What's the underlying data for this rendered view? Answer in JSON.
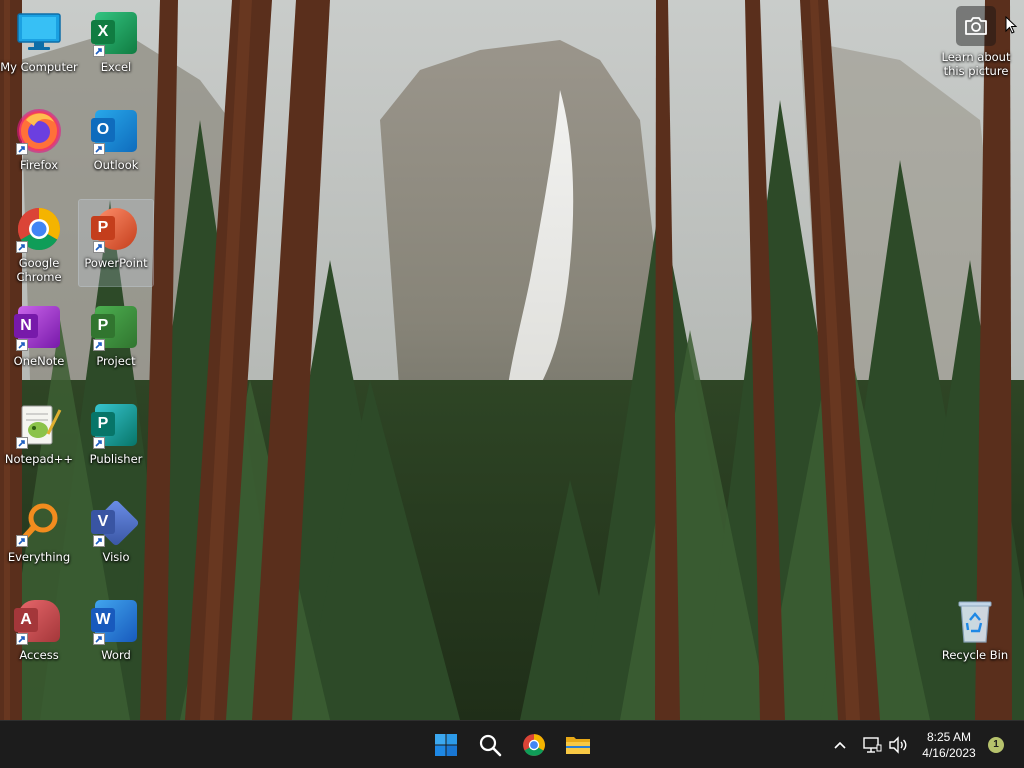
{
  "desktop": {
    "wallpaper": "forest-waterfall",
    "icons_left": [
      {
        "label": "My Computer",
        "icon": "monitor-icon"
      },
      {
        "label": "Firefox",
        "icon": "firefox-icon"
      },
      {
        "label": "Google Chrome",
        "icon": "chrome-icon"
      },
      {
        "label": "OneNote",
        "icon": "onenote-icon"
      },
      {
        "label": "Notepad++",
        "icon": "notepadpp-icon"
      },
      {
        "label": "Everything",
        "icon": "everything-search-icon"
      },
      {
        "label": "Access",
        "icon": "access-icon"
      }
    ],
    "icons_right": [
      {
        "label": "Excel",
        "icon": "excel-icon"
      },
      {
        "label": "Outlook",
        "icon": "outlook-icon"
      },
      {
        "label": "PowerPoint",
        "icon": "powerpoint-icon",
        "selected": true
      },
      {
        "label": "Project",
        "icon": "project-icon"
      },
      {
        "label": "Publisher",
        "icon": "publisher-icon"
      },
      {
        "label": "Visio",
        "icon": "visio-icon"
      },
      {
        "label": "Word",
        "icon": "word-icon"
      }
    ],
    "recycle_bin": {
      "label": "Recycle Bin",
      "icon": "recycle-bin-icon"
    },
    "learn_widget": {
      "label_line1": "Learn about",
      "label_line2": "this picture",
      "icon": "camera-icon"
    }
  },
  "taskbar": {
    "pinned": [
      {
        "name": "start",
        "icon": "windows-logo-icon"
      },
      {
        "name": "search",
        "icon": "search-icon"
      },
      {
        "name": "chrome",
        "icon": "chrome-icon"
      },
      {
        "name": "file-explorer",
        "icon": "folder-icon"
      }
    ],
    "tray": {
      "time": "8:25 AM",
      "date": "4/16/2023",
      "notification_count": "1"
    }
  },
  "colors": {
    "taskbar_bg": "#1c1c1c",
    "accent": "#0078d4",
    "excel": "#107c41",
    "word": "#185abd",
    "powerpoint": "#c43e1c",
    "outlook": "#0f6cbd",
    "onenote": "#7719aa",
    "project": "#31752f",
    "publisher": "#077568",
    "visio": "#3955a3",
    "access": "#a4373a"
  }
}
